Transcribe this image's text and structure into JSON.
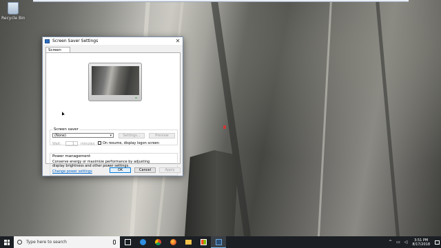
{
  "desktop": {
    "icons": [
      {
        "label": "Recycle Bin"
      }
    ]
  },
  "dialog": {
    "title": "Screen Saver Settings",
    "close_glyph": "✕",
    "tabs": [
      {
        "label": "Screen Saver"
      }
    ],
    "screensaver": {
      "group_label": "Screen saver",
      "selected": "(None)",
      "settings_label": "Settings...",
      "preview_label": "Preview",
      "wait_label": "Wait:",
      "wait_value": "1",
      "minutes_label": "minutes",
      "resume_label": "On resume, display logon screen",
      "resume_checked": false
    },
    "power": {
      "title": "Power management",
      "description": "Conserve energy or maximize performance by adjusting display brightness and other power settings.",
      "link": "Change power settings"
    },
    "buttons": {
      "ok": "OK",
      "cancel": "Cancel",
      "apply": "Apply"
    }
  },
  "taskbar": {
    "search_placeholder": "Type here to search",
    "apps": [
      {
        "name": "task-view-icon",
        "color": "#ffffff"
      },
      {
        "name": "edge-icon",
        "color": "#2f8ee0"
      },
      {
        "name": "chrome-icon",
        "color": "#e3b12c"
      },
      {
        "name": "firefox-icon",
        "color": "#e8672a"
      },
      {
        "name": "file-explorer-icon",
        "color": "#f2c24b"
      },
      {
        "name": "store-icon",
        "color": "#ffffff"
      },
      {
        "name": "screen-saver-settings-icon",
        "color": "#6fa8dc"
      }
    ],
    "tray": {
      "chevron": "^",
      "time": "3:51 PM",
      "date": "8/17/2018"
    }
  },
  "colors": {
    "accent": "#0078d7",
    "taskbar": "#1c2024",
    "link": "#0066cc"
  }
}
